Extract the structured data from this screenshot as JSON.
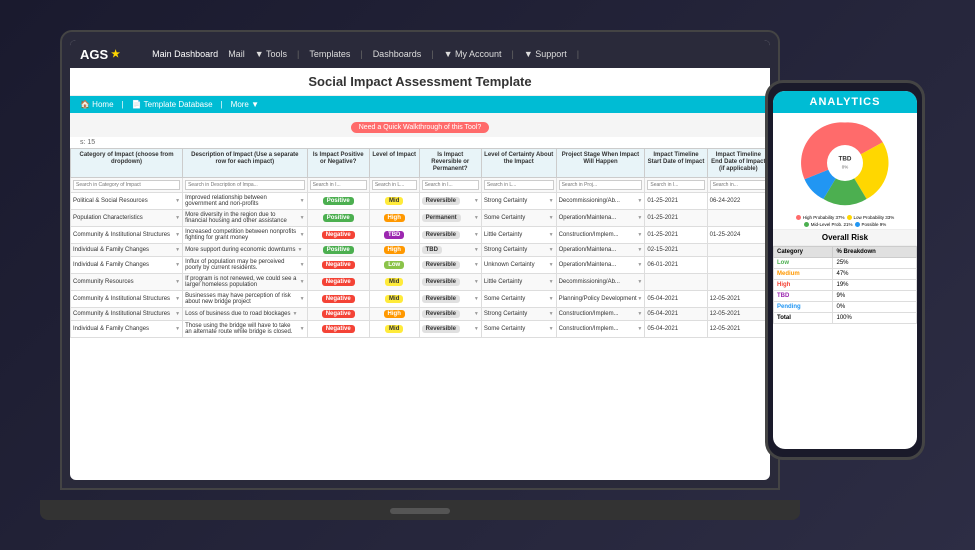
{
  "scene": {
    "background": "#1a1a2e"
  },
  "nav": {
    "logo": "AGS",
    "logo_star": "★",
    "items": [
      {
        "label": "Main Dashboard",
        "active": true
      },
      {
        "label": "Mail"
      },
      {
        "label": "▼ Tools"
      },
      {
        "label": "|"
      },
      {
        "label": "Templates"
      },
      {
        "label": "|"
      },
      {
        "label": "Dashboards"
      },
      {
        "label": "|"
      },
      {
        "label": "▼ My Account"
      },
      {
        "label": "|"
      },
      {
        "label": "▼ Support"
      },
      {
        "label": "|"
      }
    ]
  },
  "page": {
    "title": "Social Impact Assessment Template",
    "breadcrumbs": [
      {
        "label": "🏠 Home"
      },
      {
        "label": "📄 Template Database"
      },
      {
        "label": "More ▼"
      }
    ],
    "walkthrough_btn": "Need a Quick Walkthrough of this Tool?",
    "row_count": "s: 15"
  },
  "table": {
    "headers": [
      "Category of Impact (choose from dropdown)",
      "Description of Impact (Use a separate row for each impact)",
      "Is Impact Positive or Negative?",
      "Level of Impact",
      "Is Impact Reversible or Permanent?",
      "Level of Certainty About the Impact",
      "Project Stage When Impact Will Happen",
      "Impact Timeline Start Date of Impact",
      "Impact Timeline End Date of Impact (if applicable)"
    ],
    "search_placeholders": [
      "Search in Category of Impact",
      "Search in Description of Impa...",
      "Search in I...",
      "Search in L...",
      "Search in I...",
      "Search in L...",
      "Search in Proj...",
      "Search in I...",
      "Search in..."
    ],
    "rows": [
      {
        "category": "Political & Social Resources",
        "description": "Improved relationship between government and non-profits",
        "impact_type": "Positive",
        "level": "Mid",
        "reversible": "Reversible",
        "certainty": "Strong Certainty",
        "stage": "Decommissioning/Ab...",
        "start_date": "01-25-2021",
        "end_date": "06-24-2022"
      },
      {
        "category": "Population Characteristics",
        "description": "More diversity in the region due to financial housing and other assistance",
        "impact_type": "Positive",
        "level": "High",
        "reversible": "Permanent",
        "certainty": "Some Certainty",
        "stage": "Operation/Maintena...",
        "start_date": "01-25-2021",
        "end_date": ""
      },
      {
        "category": "Community & Institutional Structures",
        "description": "Increased competition between nonprofits fighting for grant money",
        "impact_type": "Negative",
        "level": "TBD",
        "reversible": "Reversible",
        "certainty": "Little Certainty",
        "stage": "Construction/Implem...",
        "start_date": "01-25-2021",
        "end_date": "01-25-2024"
      },
      {
        "category": "Individual & Family Changes",
        "description": "More support during economic downturns",
        "impact_type": "Positive",
        "level": "High",
        "reversible": "TBD",
        "certainty": "Strong Certainty",
        "stage": "Operation/Maintena...",
        "start_date": "02-15-2021",
        "end_date": ""
      },
      {
        "category": "Individual & Family Changes",
        "description": "Influx of population may be perceived poorly by current residents.",
        "impact_type": "Negative",
        "level": "Low",
        "reversible": "Reversible",
        "certainty": "Unknown Certainty",
        "stage": "Operation/Maintena...",
        "start_date": "06-01-2021",
        "end_date": ""
      },
      {
        "category": "Community Resources",
        "description": "If program is not renewed, we could see a larger homeless population",
        "impact_type": "Negative",
        "level": "Mid",
        "reversible": "Reversible",
        "certainty": "Little Certainty",
        "stage": "Decommissioning/Ab...",
        "start_date": "",
        "end_date": ""
      },
      {
        "category": "Community & Institutional Structures",
        "description": "Businesses may have perception of risk about new bridge project",
        "impact_type": "Negative",
        "level": "Mid",
        "reversible": "Reversible",
        "certainty": "Some Certainty",
        "stage": "Planning/Policy Development",
        "start_date": "05-04-2021",
        "end_date": "12-05-2021"
      },
      {
        "category": "Community & Institutional Structures",
        "description": "Loss of business due to road blockages",
        "impact_type": "Negative",
        "level": "High",
        "reversible": "Reversible",
        "certainty": "Strong Certainty",
        "stage": "Construction/Implem...",
        "start_date": "05-04-2021",
        "end_date": "12-05-2021"
      },
      {
        "category": "Individual & Family Changes",
        "description": "Those using the bridge will have to take an alternate route while bridge is closed.",
        "impact_type": "Negative",
        "level": "Mid",
        "reversible": "Reversible",
        "certainty": "Some Certainty",
        "stage": "Construction/Implem...",
        "start_date": "05-04-2021",
        "end_date": "12-05-2021"
      }
    ]
  },
  "analytics": {
    "title": "ANALYTICS",
    "pie_data": [
      {
        "label": "High Probability",
        "value": 37,
        "color": "#ff6b6b",
        "percent": "37%"
      },
      {
        "label": "Low Probability",
        "value": 33,
        "color": "#ffd700",
        "percent": "33%"
      },
      {
        "label": "Mid-Level Probability",
        "value": 21,
        "color": "#4caf50",
        "percent": "21%"
      },
      {
        "label": "Possible",
        "value": 9,
        "color": "#2196f3",
        "percent": "9%"
      }
    ],
    "overall_risk_title": "Overall Risk",
    "risk_table": {
      "headers": [
        "Category",
        "% Breakdown"
      ],
      "rows": [
        {
          "category": "Low",
          "percent": "25%",
          "class": "risk-low"
        },
        {
          "category": "Medium",
          "percent": "47%",
          "class": "risk-medium"
        },
        {
          "category": "High",
          "percent": "19%",
          "class": "risk-high"
        },
        {
          "category": "TBD",
          "percent": "9%",
          "class": "risk-tbd"
        },
        {
          "category": "Pending",
          "percent": "0%",
          "class": "risk-pending"
        },
        {
          "category": "Total",
          "percent": "100%",
          "class": "risk-total"
        }
      ]
    }
  }
}
